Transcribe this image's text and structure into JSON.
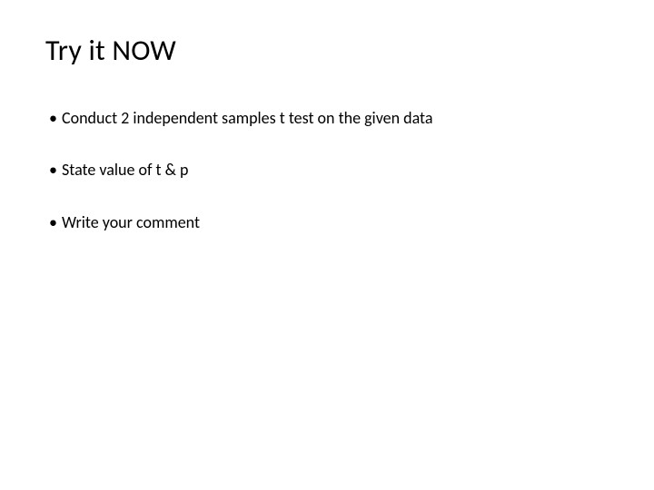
{
  "title": "Try it NOW",
  "bullets": [
    "Conduct 2 independent samples t test on the given data",
    "State value of t & p",
    "Write your comment"
  ]
}
